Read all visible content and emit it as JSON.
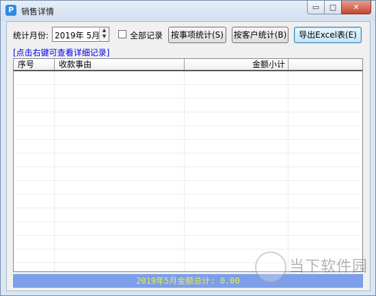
{
  "window": {
    "title": "销售详情",
    "app_icon_letter": "P",
    "controls": {
      "minimize": "▭",
      "maximize": "□",
      "close": "✕"
    }
  },
  "toolbar": {
    "month_label": "统计月份:",
    "month_value": "2019年  5月",
    "spin_up": "▲",
    "spin_down": "▼",
    "all_records_label": "全部记录",
    "all_records_checked": false,
    "by_item_button": "按事项统计(S)",
    "by_customer_button": "按客户统计(B)",
    "export_excel_button": "导出Excel表(E)"
  },
  "hint": "[点击右键可查看详细记录]",
  "table": {
    "columns": [
      "序号",
      "收款事由",
      "金额小计",
      ""
    ],
    "rows": []
  },
  "status": {
    "total_text": "2019年5月金额总计: 0.00"
  },
  "watermark": {
    "text": "当下软件园"
  },
  "colors": {
    "status_bar_bg": "#7d9ee9",
    "status_text": "#e8f04a",
    "hint_text": "#0000ee",
    "close_button": "#c7452f"
  }
}
